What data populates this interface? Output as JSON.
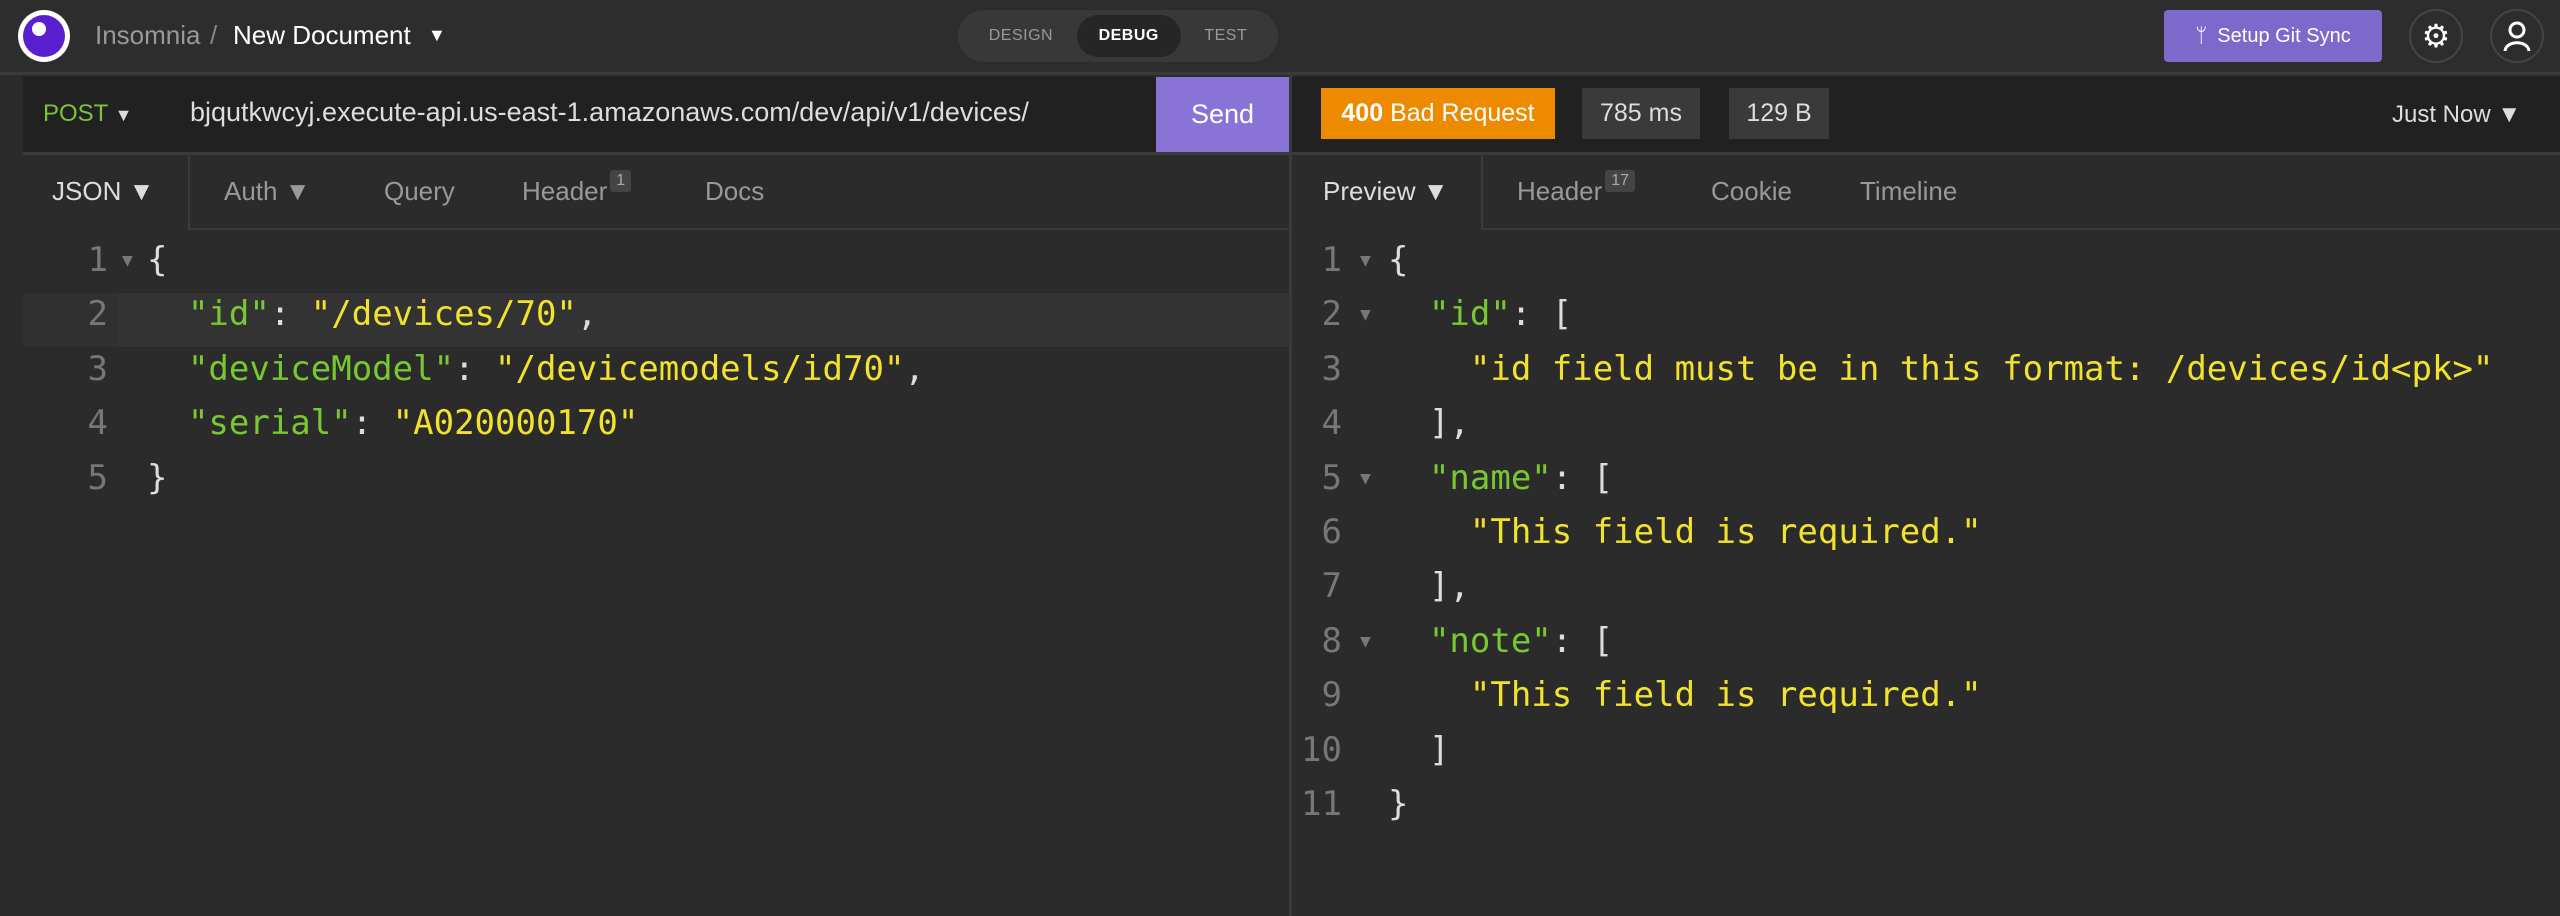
{
  "app": {
    "name": "Insomnia",
    "separator": "/",
    "document": "New Document",
    "caret": "▼"
  },
  "modes": [
    "DESIGN",
    "DEBUG",
    "TEST"
  ],
  "active_mode": "DEBUG",
  "git_sync": {
    "label": "Setup Git Sync",
    "icon": "git-branch-icon"
  },
  "icons": {
    "settings": "gear-icon",
    "account": "user-icon"
  },
  "request": {
    "method": "POST",
    "url": "bjqutkwcyj.execute-api.us-east-1.amazonaws.com/dev/api/v1/devices/",
    "send_label": "Send",
    "tabs": [
      {
        "label": "JSON ▼"
      },
      {
        "label": "Auth ▼"
      },
      {
        "label": "Query"
      },
      {
        "label": "Header",
        "count": "1"
      },
      {
        "label": "Docs"
      }
    ],
    "body_lines": [
      [
        {
          "t": "p",
          "v": "{"
        }
      ],
      [
        {
          "t": "p",
          "v": "  "
        },
        {
          "t": "k",
          "v": "\"id\""
        },
        {
          "t": "p",
          "v": ": "
        },
        {
          "t": "s",
          "v": "\"/devices/70\""
        },
        {
          "t": "p",
          "v": ","
        }
      ],
      [
        {
          "t": "p",
          "v": "  "
        },
        {
          "t": "k",
          "v": "\"deviceModel\""
        },
        {
          "t": "p",
          "v": ": "
        },
        {
          "t": "s",
          "v": "\"/devicemodels/id70\""
        },
        {
          "t": "p",
          "v": ","
        }
      ],
      [
        {
          "t": "p",
          "v": "  "
        },
        {
          "t": "k",
          "v": "\"serial\""
        },
        {
          "t": "p",
          "v": ": "
        },
        {
          "t": "s",
          "v": "\"A020000170\""
        }
      ],
      [
        {
          "t": "p",
          "v": "}"
        }
      ]
    ]
  },
  "response": {
    "status_code": "400",
    "status_text": "Bad Request",
    "time": "785 ms",
    "size": "129 B",
    "history": "Just Now ▼",
    "status_color": "#ee8a00",
    "tabs": [
      {
        "label": "Preview ▼"
      },
      {
        "label": "Header",
        "count": "17"
      },
      {
        "label": "Cookie"
      },
      {
        "label": "Timeline"
      }
    ],
    "body_lines": [
      [
        {
          "t": "p",
          "v": "{"
        }
      ],
      [
        {
          "t": "p",
          "v": "  "
        },
        {
          "t": "k",
          "v": "\"id\""
        },
        {
          "t": "p",
          "v": ": ["
        }
      ],
      [
        {
          "t": "p",
          "v": "    "
        },
        {
          "t": "s",
          "v": "\"id field must be in this format: /devices/id<pk>\""
        }
      ],
      [
        {
          "t": "p",
          "v": "  ],"
        }
      ],
      [
        {
          "t": "p",
          "v": "  "
        },
        {
          "t": "k",
          "v": "\"name\""
        },
        {
          "t": "p",
          "v": ": ["
        }
      ],
      [
        {
          "t": "p",
          "v": "    "
        },
        {
          "t": "s",
          "v": "\"This field is required.\""
        }
      ],
      [
        {
          "t": "p",
          "v": "  ],"
        }
      ],
      [
        {
          "t": "p",
          "v": "  "
        },
        {
          "t": "k",
          "v": "\"note\""
        },
        {
          "t": "p",
          "v": ": ["
        }
      ],
      [
        {
          "t": "p",
          "v": "    "
        },
        {
          "t": "s",
          "v": "\"This field is required.\""
        }
      ],
      [
        {
          "t": "p",
          "v": "  ]"
        }
      ],
      [
        {
          "t": "p",
          "v": "}"
        }
      ]
    ],
    "fold_lines": [
      2,
      5,
      8
    ]
  }
}
